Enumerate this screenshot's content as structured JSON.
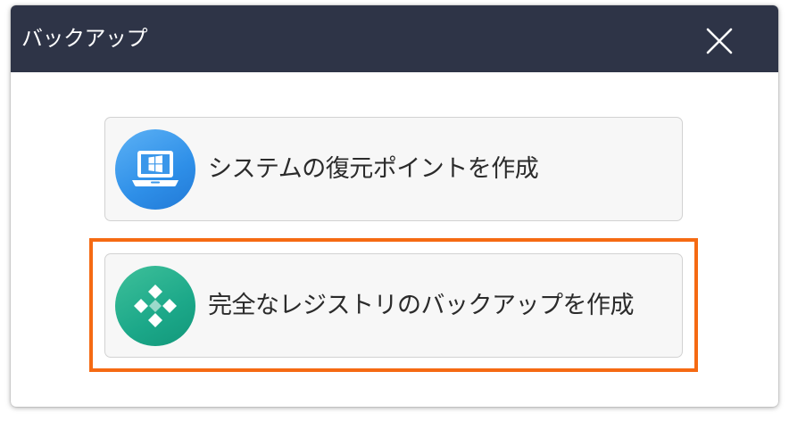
{
  "dialog": {
    "title": "バックアップ",
    "close_icon": "close-icon"
  },
  "options": [
    {
      "label": "システムの復元ポイントを作成",
      "icon": "windows-laptop-icon",
      "icon_color": "#2e8fe8"
    },
    {
      "label": "完全なレジストリのバックアップを作成",
      "icon": "registry-diamond-icon",
      "icon_color": "#1ca889",
      "highlighted": true
    }
  ],
  "colors": {
    "titlebar": "#2e3447",
    "highlight_border": "#f56a13",
    "option_background": "#f7f7f7"
  }
}
